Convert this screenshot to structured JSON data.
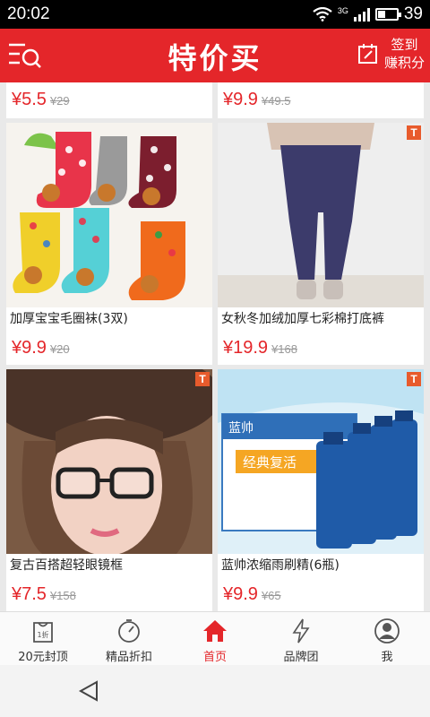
{
  "status": {
    "time": "20:02",
    "network": "3G",
    "battery": "39",
    "battery_level": 0.39
  },
  "header": {
    "title": "特价买",
    "checkin_line1": "签到",
    "checkin_line2": "赚积分"
  },
  "accent": "#e4262a",
  "partial_row": [
    {
      "price": "¥5.5",
      "old": "¥29"
    },
    {
      "price": "¥9.9",
      "old": "¥49.5"
    }
  ],
  "products": [
    {
      "name": "加厚宝宝毛圈袜(3双)",
      "price": "¥9.9",
      "old": "¥20",
      "badge": ""
    },
    {
      "name": "女秋冬加绒加厚七彩棉打底裤",
      "price": "¥19.9",
      "old": "¥168",
      "badge": "T"
    },
    {
      "name": "复古百搭超轻眼镜框",
      "price": "¥7.5",
      "old": "¥158",
      "badge": "T"
    },
    {
      "name": "蓝帅浓缩雨刷精(6瓶)",
      "price": "¥9.9",
      "old": "¥65",
      "badge": "T"
    }
  ],
  "product_image_text": {
    "brand": "蓝帅",
    "slogan": "经典复活"
  },
  "tabs": [
    {
      "label": "20元封顶",
      "icon": "bag-1折-icon",
      "icon_text": "1折"
    },
    {
      "label": "精品折扣",
      "icon": "timer-icon"
    },
    {
      "label": "首页",
      "icon": "home-icon"
    },
    {
      "label": "品牌团",
      "icon": "lightning-icon"
    },
    {
      "label": "我",
      "icon": "user-icon"
    }
  ]
}
